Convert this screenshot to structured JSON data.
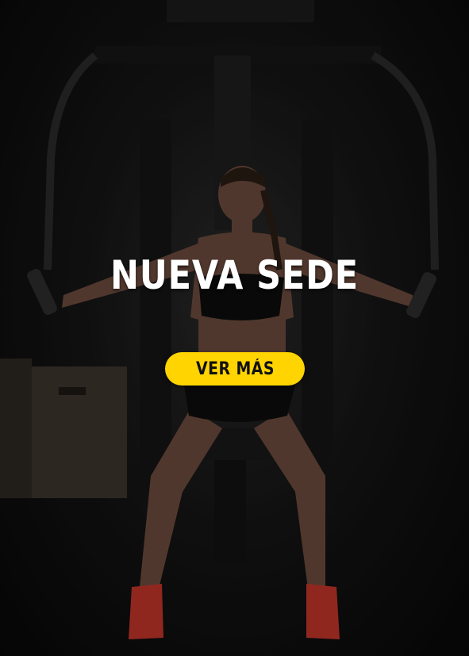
{
  "banner": {
    "title": "NUEVA SEDE",
    "cta_label": "VER MÁS"
  },
  "colors": {
    "accent": "#ffd400",
    "title_text": "#ffffff",
    "cta_text": "#111111",
    "background": "#0b0b0b"
  }
}
